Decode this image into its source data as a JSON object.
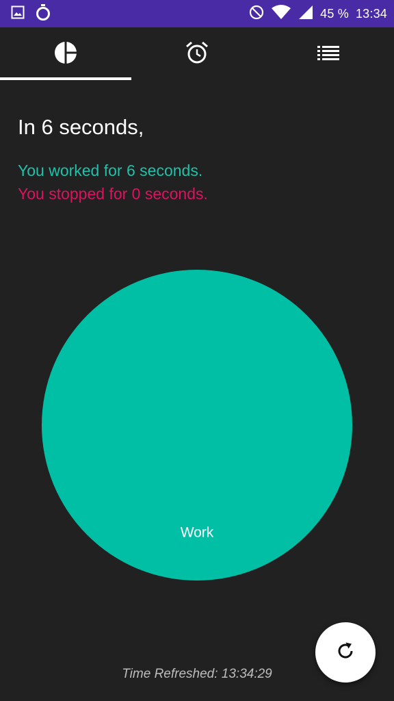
{
  "status_bar": {
    "icons_left": [
      "image-icon",
      "timer-icon"
    ],
    "icons_right": [
      "do-not-disturb-icon",
      "wifi-icon",
      "signal-icon"
    ],
    "battery": "45 %",
    "time": "13:34"
  },
  "tabs": [
    {
      "icon": "pie-chart-icon",
      "selected": true
    },
    {
      "icon": "alarm-clock-icon",
      "selected": false
    },
    {
      "icon": "list-icon",
      "selected": false
    }
  ],
  "summary": {
    "title": "In 6 seconds,",
    "worked": "You worked for 6 seconds.",
    "stopped": "You stopped for 0 seconds."
  },
  "chart_data": {
    "type": "pie",
    "slices": [
      {
        "label": "Work",
        "value": 6,
        "color": "#00bfa5"
      },
      {
        "label": "",
        "value": 0,
        "color": "#e0115f"
      }
    ]
  },
  "footer": {
    "refreshed": "Time Refreshed: 13:34:29"
  },
  "colors": {
    "status_bar": "#4a2ba6",
    "background": "#212121",
    "work": "#00bfa5",
    "stop": "#e0115f",
    "worked_text": "#1ec1a9"
  }
}
